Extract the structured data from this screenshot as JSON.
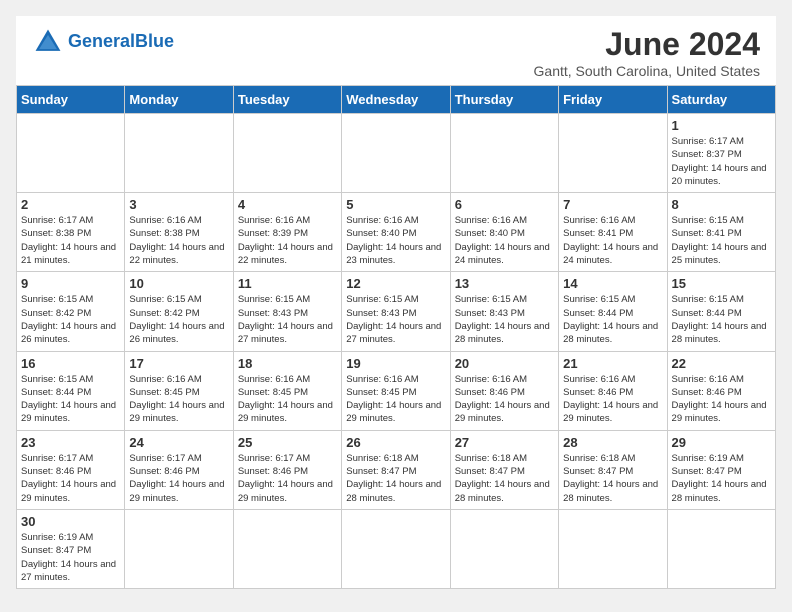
{
  "header": {
    "logo_general": "General",
    "logo_blue": "Blue",
    "title": "June 2024",
    "subtitle": "Gantt, South Carolina, United States"
  },
  "weekdays": [
    "Sunday",
    "Monday",
    "Tuesday",
    "Wednesday",
    "Thursday",
    "Friday",
    "Saturday"
  ],
  "weeks": [
    [
      {
        "day": "",
        "empty": true
      },
      {
        "day": "",
        "empty": true
      },
      {
        "day": "",
        "empty": true
      },
      {
        "day": "",
        "empty": true
      },
      {
        "day": "",
        "empty": true
      },
      {
        "day": "",
        "empty": true
      },
      {
        "day": "1",
        "sunrise": "Sunrise: 6:17 AM",
        "sunset": "Sunset: 8:37 PM",
        "daylight": "Daylight: 14 hours and 20 minutes."
      }
    ],
    [
      {
        "day": "2",
        "sunrise": "Sunrise: 6:17 AM",
        "sunset": "Sunset: 8:38 PM",
        "daylight": "Daylight: 14 hours and 21 minutes."
      },
      {
        "day": "3",
        "sunrise": "Sunrise: 6:16 AM",
        "sunset": "Sunset: 8:38 PM",
        "daylight": "Daylight: 14 hours and 22 minutes."
      },
      {
        "day": "4",
        "sunrise": "Sunrise: 6:16 AM",
        "sunset": "Sunset: 8:39 PM",
        "daylight": "Daylight: 14 hours and 22 minutes."
      },
      {
        "day": "5",
        "sunrise": "Sunrise: 6:16 AM",
        "sunset": "Sunset: 8:40 PM",
        "daylight": "Daylight: 14 hours and 23 minutes."
      },
      {
        "day": "6",
        "sunrise": "Sunrise: 6:16 AM",
        "sunset": "Sunset: 8:40 PM",
        "daylight": "Daylight: 14 hours and 24 minutes."
      },
      {
        "day": "7",
        "sunrise": "Sunrise: 6:16 AM",
        "sunset": "Sunset: 8:41 PM",
        "daylight": "Daylight: 14 hours and 24 minutes."
      },
      {
        "day": "8",
        "sunrise": "Sunrise: 6:15 AM",
        "sunset": "Sunset: 8:41 PM",
        "daylight": "Daylight: 14 hours and 25 minutes."
      }
    ],
    [
      {
        "day": "9",
        "sunrise": "Sunrise: 6:15 AM",
        "sunset": "Sunset: 8:42 PM",
        "daylight": "Daylight: 14 hours and 26 minutes."
      },
      {
        "day": "10",
        "sunrise": "Sunrise: 6:15 AM",
        "sunset": "Sunset: 8:42 PM",
        "daylight": "Daylight: 14 hours and 26 minutes."
      },
      {
        "day": "11",
        "sunrise": "Sunrise: 6:15 AM",
        "sunset": "Sunset: 8:43 PM",
        "daylight": "Daylight: 14 hours and 27 minutes."
      },
      {
        "day": "12",
        "sunrise": "Sunrise: 6:15 AM",
        "sunset": "Sunset: 8:43 PM",
        "daylight": "Daylight: 14 hours and 27 minutes."
      },
      {
        "day": "13",
        "sunrise": "Sunrise: 6:15 AM",
        "sunset": "Sunset: 8:43 PM",
        "daylight": "Daylight: 14 hours and 28 minutes."
      },
      {
        "day": "14",
        "sunrise": "Sunrise: 6:15 AM",
        "sunset": "Sunset: 8:44 PM",
        "daylight": "Daylight: 14 hours and 28 minutes."
      },
      {
        "day": "15",
        "sunrise": "Sunrise: 6:15 AM",
        "sunset": "Sunset: 8:44 PM",
        "daylight": "Daylight: 14 hours and 28 minutes."
      }
    ],
    [
      {
        "day": "16",
        "sunrise": "Sunrise: 6:15 AM",
        "sunset": "Sunset: 8:44 PM",
        "daylight": "Daylight: 14 hours and 29 minutes."
      },
      {
        "day": "17",
        "sunrise": "Sunrise: 6:16 AM",
        "sunset": "Sunset: 8:45 PM",
        "daylight": "Daylight: 14 hours and 29 minutes."
      },
      {
        "day": "18",
        "sunrise": "Sunrise: 6:16 AM",
        "sunset": "Sunset: 8:45 PM",
        "daylight": "Daylight: 14 hours and 29 minutes."
      },
      {
        "day": "19",
        "sunrise": "Sunrise: 6:16 AM",
        "sunset": "Sunset: 8:45 PM",
        "daylight": "Daylight: 14 hours and 29 minutes."
      },
      {
        "day": "20",
        "sunrise": "Sunrise: 6:16 AM",
        "sunset": "Sunset: 8:46 PM",
        "daylight": "Daylight: 14 hours and 29 minutes."
      },
      {
        "day": "21",
        "sunrise": "Sunrise: 6:16 AM",
        "sunset": "Sunset: 8:46 PM",
        "daylight": "Daylight: 14 hours and 29 minutes."
      },
      {
        "day": "22",
        "sunrise": "Sunrise: 6:16 AM",
        "sunset": "Sunset: 8:46 PM",
        "daylight": "Daylight: 14 hours and 29 minutes."
      }
    ],
    [
      {
        "day": "23",
        "sunrise": "Sunrise: 6:17 AM",
        "sunset": "Sunset: 8:46 PM",
        "daylight": "Daylight: 14 hours and 29 minutes."
      },
      {
        "day": "24",
        "sunrise": "Sunrise: 6:17 AM",
        "sunset": "Sunset: 8:46 PM",
        "daylight": "Daylight: 14 hours and 29 minutes."
      },
      {
        "day": "25",
        "sunrise": "Sunrise: 6:17 AM",
        "sunset": "Sunset: 8:46 PM",
        "daylight": "Daylight: 14 hours and 29 minutes."
      },
      {
        "day": "26",
        "sunrise": "Sunrise: 6:18 AM",
        "sunset": "Sunset: 8:47 PM",
        "daylight": "Daylight: 14 hours and 28 minutes."
      },
      {
        "day": "27",
        "sunrise": "Sunrise: 6:18 AM",
        "sunset": "Sunset: 8:47 PM",
        "daylight": "Daylight: 14 hours and 28 minutes."
      },
      {
        "day": "28",
        "sunrise": "Sunrise: 6:18 AM",
        "sunset": "Sunset: 8:47 PM",
        "daylight": "Daylight: 14 hours and 28 minutes."
      },
      {
        "day": "29",
        "sunrise": "Sunrise: 6:19 AM",
        "sunset": "Sunset: 8:47 PM",
        "daylight": "Daylight: 14 hours and 28 minutes."
      }
    ],
    [
      {
        "day": "30",
        "sunrise": "Sunrise: 6:19 AM",
        "sunset": "Sunset: 8:47 PM",
        "daylight": "Daylight: 14 hours and 27 minutes."
      },
      {
        "day": "",
        "empty": true
      },
      {
        "day": "",
        "empty": true
      },
      {
        "day": "",
        "empty": true
      },
      {
        "day": "",
        "empty": true
      },
      {
        "day": "",
        "empty": true
      },
      {
        "day": "",
        "empty": true
      }
    ]
  ]
}
